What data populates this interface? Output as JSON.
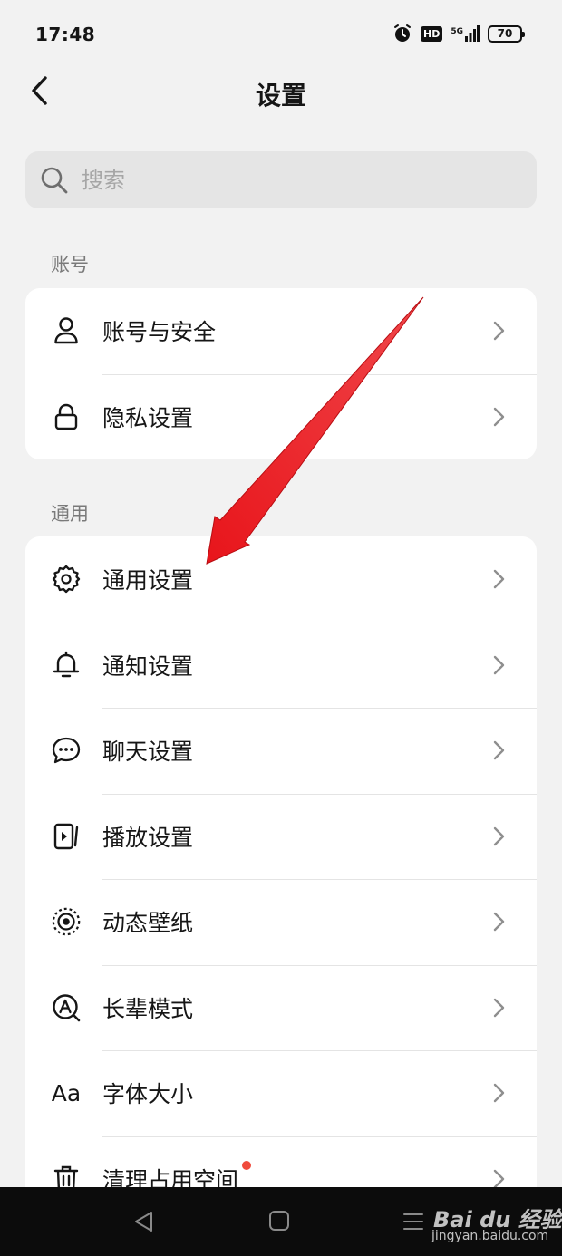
{
  "status_bar": {
    "time": "17:48",
    "hd_badge": "HD",
    "network": "5G",
    "battery": "70",
    "icons": [
      "alarm-icon",
      "hd-icon",
      "signal-icon",
      "battery-icon"
    ]
  },
  "header": {
    "back_icon": "chevron-left-icon",
    "title": "设置"
  },
  "search": {
    "placeholder": "搜索",
    "value": "",
    "icon": "search-icon"
  },
  "sections": {
    "account": {
      "title": "账号",
      "items": [
        {
          "label": "账号与安全",
          "icon": "user-icon"
        },
        {
          "label": "隐私设置",
          "icon": "lock-icon"
        }
      ]
    },
    "general": {
      "title": "通用",
      "items": [
        {
          "label": "通用设置",
          "icon": "gear-icon"
        },
        {
          "label": "通知设置",
          "icon": "bell-icon"
        },
        {
          "label": "聊天设置",
          "icon": "chat-bubble-icon"
        },
        {
          "label": "播放设置",
          "icon": "play-icon"
        },
        {
          "label": "动态壁纸",
          "icon": "wallpaper-icon"
        },
        {
          "label": "长辈模式",
          "icon": "elder-mode-icon"
        },
        {
          "label": "字体大小",
          "icon": "font-size-icon",
          "icon_text": "Aa"
        },
        {
          "label": "清理占用空间",
          "icon": "trash-icon",
          "has_badge": true
        }
      ]
    }
  },
  "nav_bar": {
    "icons": [
      "nav-back-icon",
      "nav-home-icon",
      "nav-menu-icon"
    ],
    "watermark": "Bai du 经验",
    "watermark_url": "jingyan.baidu.com"
  },
  "colors": {
    "background": "#f2f2f2",
    "card": "#ffffff",
    "annotation_arrow": "#e8151b",
    "badge_dot": "#f04a3c"
  }
}
